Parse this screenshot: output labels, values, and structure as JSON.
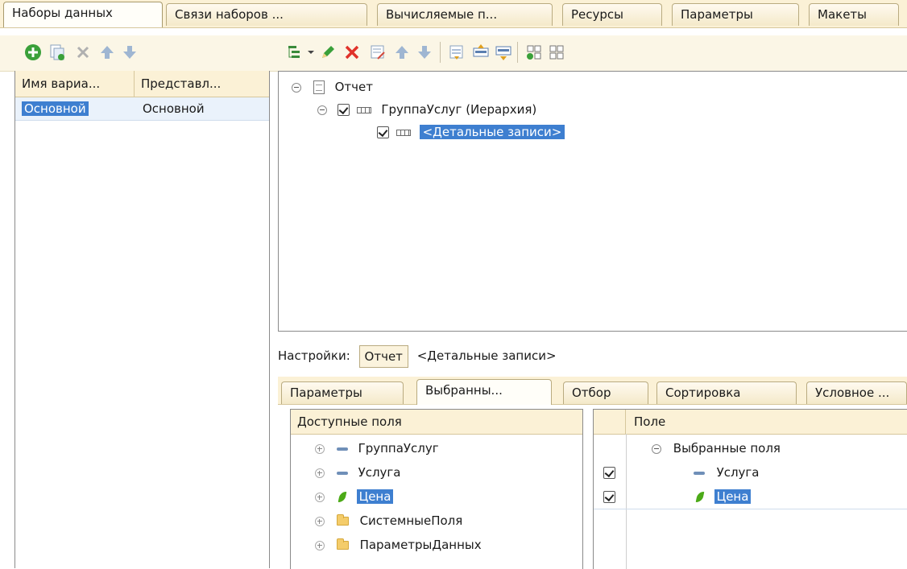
{
  "top_tabs": [
    "Наборы данных",
    "Связи наборов ...",
    "Вычисляемые п...",
    "Ресурсы",
    "Параметры",
    "Макеты"
  ],
  "variants": {
    "col_name": "Имя вариа...",
    "col_repr": "Представл...",
    "rows": [
      {
        "name": "Основной",
        "repr": "Основной"
      }
    ]
  },
  "tree": {
    "report": "Отчет",
    "group": "ГруппаУслуг (Иерархия)",
    "detail": "<Детальные записи>"
  },
  "settings": {
    "label": "Настройки:",
    "button": "Отчет",
    "current": "<Детальные записи>"
  },
  "bottom_tabs": [
    "Параметры",
    "Выбранны...",
    "Отбор",
    "Сортировка",
    "Условное ..."
  ],
  "available": {
    "header": "Доступные поля",
    "items": [
      "ГруппаУслуг",
      "Услуга",
      "Цена",
      "СистемныеПоля",
      "ПараметрыДанных"
    ]
  },
  "selected": {
    "header": "Поле",
    "root": "Выбранные поля",
    "items": [
      "Услуга",
      "Цена"
    ]
  },
  "colors": {
    "selection": "#3e7fd0",
    "tab_bg": "#fbf1d6",
    "add": "#3aa03a",
    "delete": "#e0322a"
  }
}
